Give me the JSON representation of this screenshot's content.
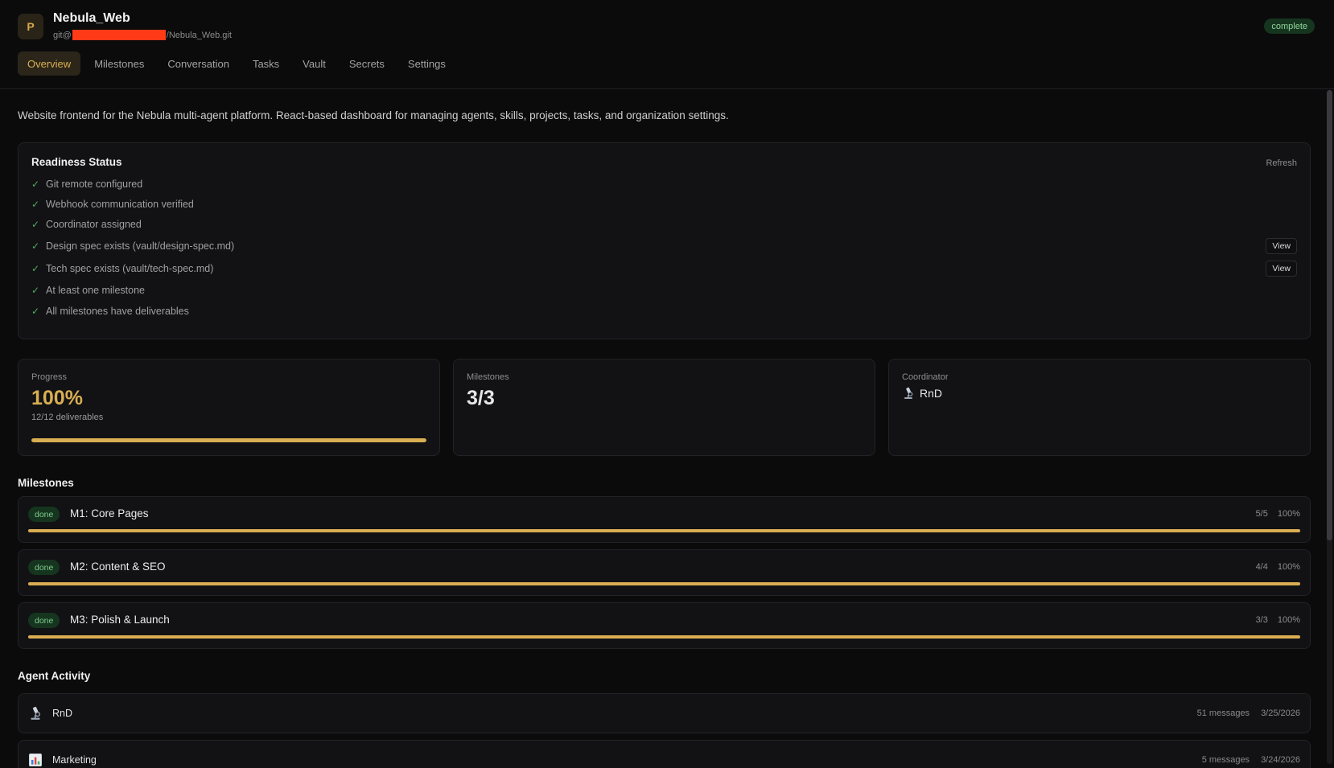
{
  "project": {
    "avatar_letter": "P",
    "name": "Nebula_Web",
    "repo_prefix": "git@",
    "repo_suffix": "/Nebula_Web.git",
    "status": "complete"
  },
  "tabs": [
    {
      "label": "Overview",
      "active": true
    },
    {
      "label": "Milestones",
      "active": false
    },
    {
      "label": "Conversation",
      "active": false
    },
    {
      "label": "Tasks",
      "active": false
    },
    {
      "label": "Vault",
      "active": false
    },
    {
      "label": "Secrets",
      "active": false
    },
    {
      "label": "Settings",
      "active": false
    }
  ],
  "description": "Website frontend for the Nebula multi-agent platform. React-based dashboard for managing agents, skills, projects, tasks, and organization settings.",
  "readiness": {
    "title": "Readiness Status",
    "refresh_label": "Refresh",
    "items": [
      {
        "label": "Git remote configured"
      },
      {
        "label": "Webhook communication verified"
      },
      {
        "label": "Coordinator assigned"
      },
      {
        "label": "Design spec exists (vault/design-spec.md)",
        "action": "View"
      },
      {
        "label": "Tech spec exists (vault/tech-spec.md)",
        "action": "View"
      },
      {
        "label": "At least one milestone"
      },
      {
        "label": "All milestones have deliverables"
      }
    ]
  },
  "stats": {
    "progress": {
      "label": "Progress",
      "value": "100%",
      "sub": "12/12 deliverables",
      "fraction": 1.0
    },
    "milestones": {
      "label": "Milestones",
      "value": "3/3"
    },
    "coordinator": {
      "label": "Coordinator",
      "name": "RnD",
      "icon": "microscope-icon"
    }
  },
  "milestones": {
    "title": "Milestones",
    "items": [
      {
        "status": "done",
        "name": "M1: Core Pages",
        "count": "5/5",
        "percent": "100%",
        "fraction": 1.0
      },
      {
        "status": "done",
        "name": "M2: Content & SEO",
        "count": "4/4",
        "percent": "100%",
        "fraction": 1.0
      },
      {
        "status": "done",
        "name": "M3: Polish & Launch",
        "count": "3/3",
        "percent": "100%",
        "fraction": 1.0
      }
    ]
  },
  "agent_activity": {
    "title": "Agent Activity",
    "items": [
      {
        "name": "RnD",
        "icon": "microscope-icon",
        "messages": "51 messages",
        "date": "3/25/2026"
      },
      {
        "name": "Marketing",
        "icon": "bar-chart-icon",
        "messages": "5 messages",
        "date": "3/24/2026"
      }
    ]
  },
  "colors": {
    "accent_gold": "#d9ae52",
    "success_green": "#4caf63",
    "badge_bg": "#16351f"
  }
}
